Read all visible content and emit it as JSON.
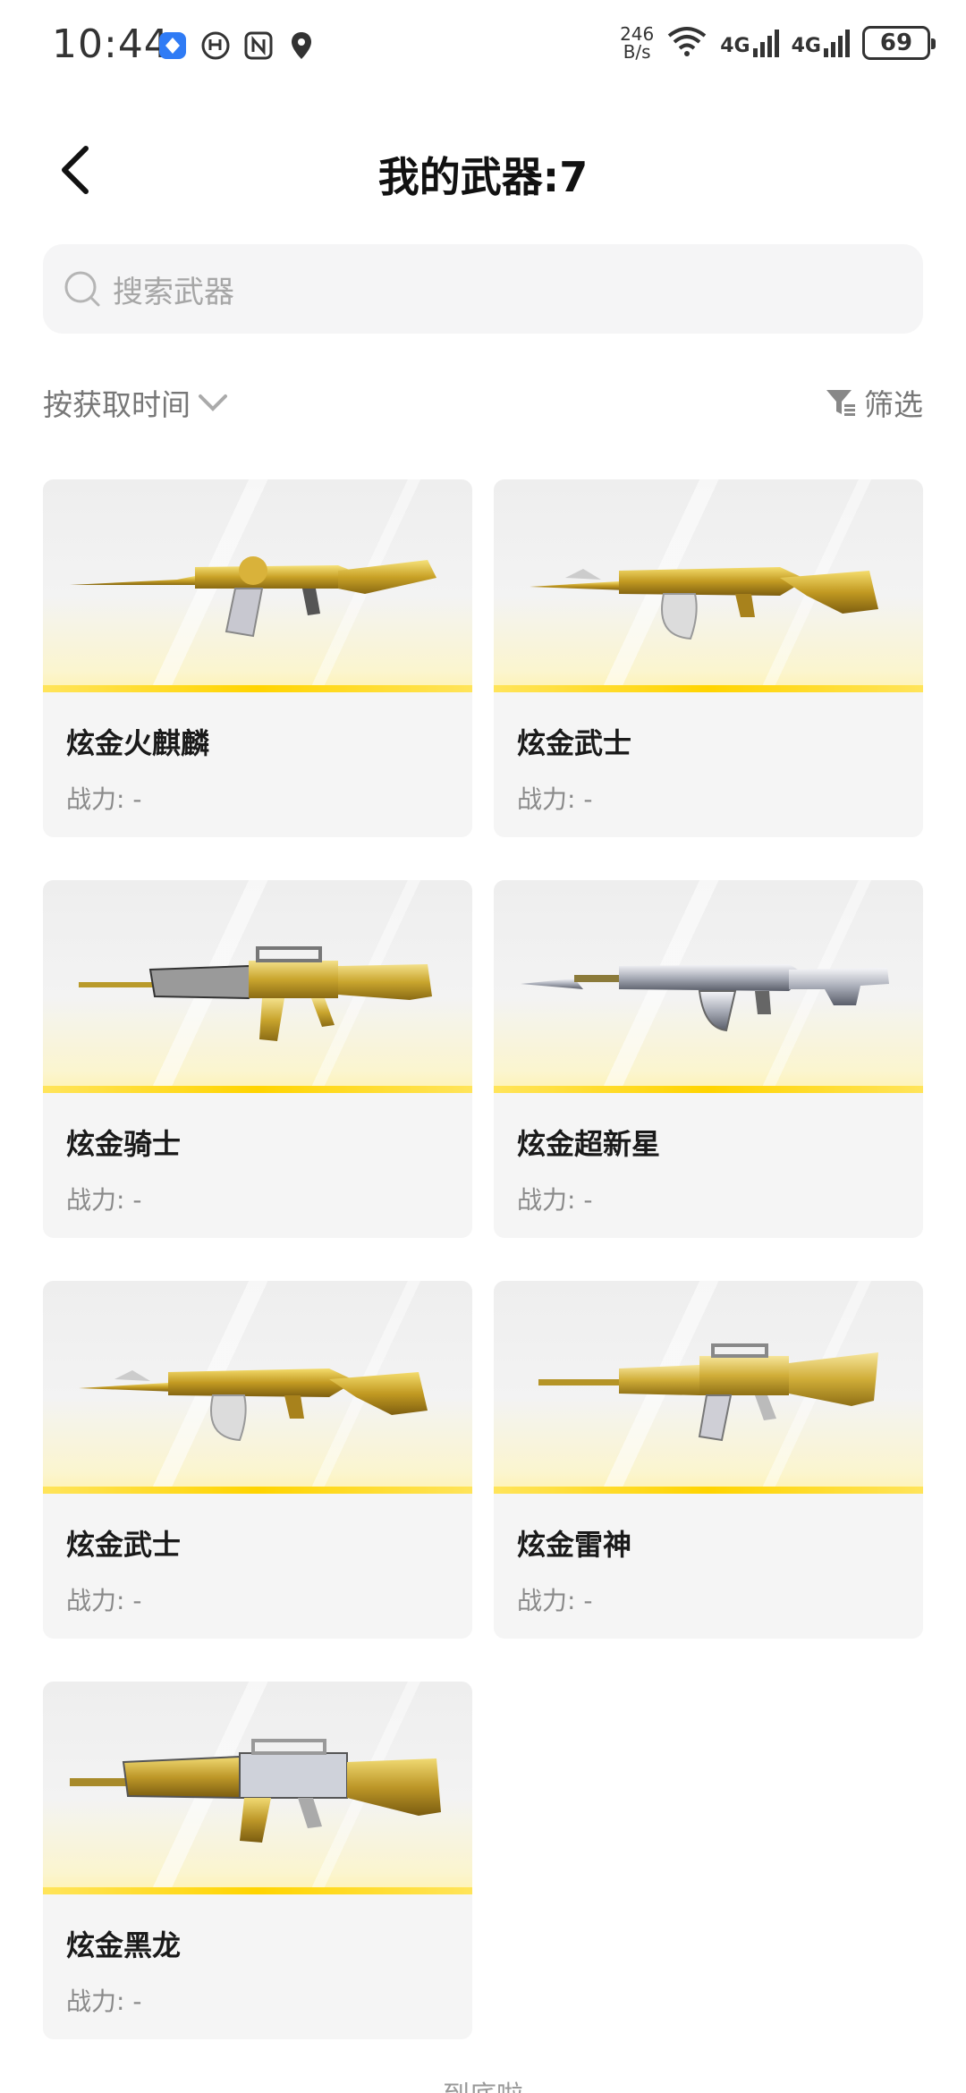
{
  "status_bar": {
    "time": "10:44",
    "speed_value": "246",
    "speed_unit": "B/s",
    "network_1": "4G",
    "network_2": "4G",
    "battery": "69"
  },
  "header": {
    "title": "我的武器:7"
  },
  "search": {
    "placeholder": "搜索武器"
  },
  "filters": {
    "sort_label": "按获取时间",
    "filter_label": "筛选"
  },
  "weapons": [
    {
      "name": "炫金火麒麟",
      "power": "战力: -",
      "model": "ak"
    },
    {
      "name": "炫金武士",
      "power": "战力: -",
      "model": "ak-drum"
    },
    {
      "name": "炫金骑士",
      "power": "战力: -",
      "model": "m4"
    },
    {
      "name": "炫金超新星",
      "power": "战力: -",
      "model": "ak-silver"
    },
    {
      "name": "炫金武士",
      "power": "战力: -",
      "model": "ak-drum"
    },
    {
      "name": "炫金雷神",
      "power": "战力: -",
      "model": "m4-short"
    },
    {
      "name": "炫金黑龙",
      "power": "战力: -",
      "model": "m4-dragon"
    }
  ],
  "footer": {
    "hint": "到底啦"
  }
}
